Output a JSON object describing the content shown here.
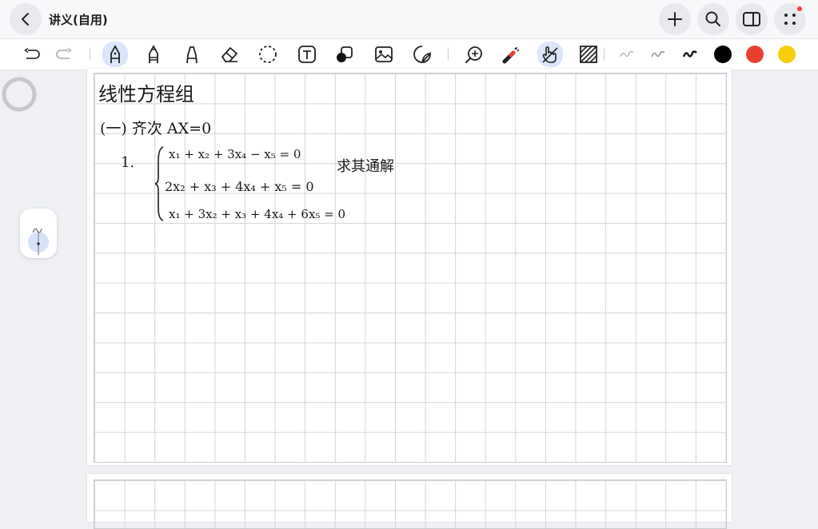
{
  "header": {
    "title": "讲义(自用)",
    "back_icon": "chevron-left-icon",
    "actions": [
      "plus-icon",
      "search-icon",
      "sidebar-panel-icon",
      "more-dots-icon"
    ]
  },
  "toolbar": {
    "tools": [
      "undo-icon",
      "redo-icon",
      "fountain-pen-icon",
      "pencil-icon",
      "highlighter-icon",
      "eraser-icon",
      "lasso-icon",
      "text-box-icon",
      "shapes-icon",
      "image-icon",
      "sticker-icon",
      "zoom-icon",
      "laser-pointer-icon",
      "hand-touch-icon",
      "hatch-pattern-icon"
    ],
    "stroke_widths": [
      "thin",
      "medium",
      "thick"
    ],
    "colors": [
      "#000000",
      "#e9412e",
      "#f7cf0a"
    ]
  },
  "note": {
    "heading": "线性方程组",
    "section": "(一) 齐次  AX=0",
    "item_number": "1.",
    "equations": [
      "x₁ + x₂ + 3x₄ − x₅ = 0",
      "2x₂ + x₃ + 4x₄ + x₅ = 0",
      "x₁ + 3x₂ + x₃ + 4x₄ + 6x₅ = 0"
    ],
    "side_note": "求其通解"
  }
}
